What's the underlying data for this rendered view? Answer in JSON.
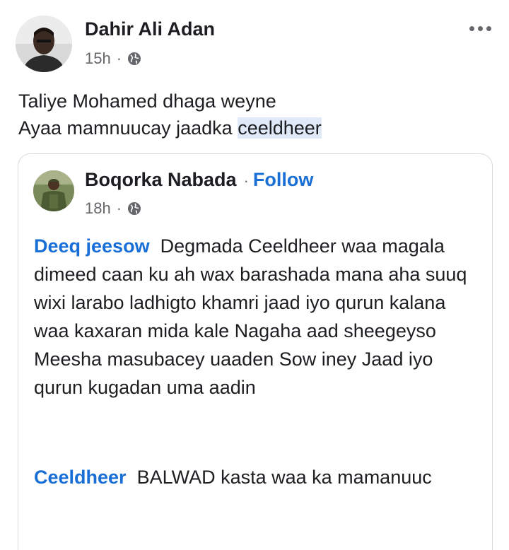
{
  "post": {
    "author": "Dahir Ali Adan",
    "time": "15h",
    "separator": "·",
    "line1": "Taliye Mohamed dhaga weyne",
    "line2_prefix": "Ayaa mamnuucay jaadka ",
    "line2_highlight": "ceeldheer"
  },
  "shared": {
    "author": "Boqorka Nabada",
    "separator": "·",
    "follow": "Follow",
    "time": "18h",
    "comment1_author": "Deeq jeesow",
    "comment1_text": "Degmada Ceeldheer  waa magala dimeed caan  ku ah wax barashada mana aha suuq wixi larabo  ladhigto khamri jaad iyo qurun kalana waa kaxaran  mida kale Nagaha aad sheegeyso Meesha masubacey  uaaden Sow iney Jaad iyo qurun kugadan uma aadin",
    "comment2_author": "Ceeldheer",
    "comment2_text": "BALWAD kasta waa ka mamanuuc"
  },
  "icons": {
    "globe": "globe-icon",
    "more": "more-options-icon"
  },
  "colors": {
    "link_blue": "#1a6fd6",
    "highlight": "#dfe9f8",
    "meta_gray": "#65676b"
  }
}
